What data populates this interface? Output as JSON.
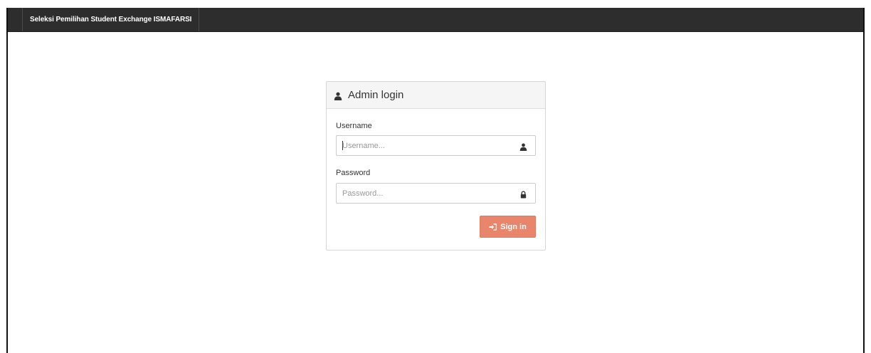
{
  "navbar": {
    "brand": "Seleksi Pemilihan Student Exchange ISMAFARSI"
  },
  "login_panel": {
    "title": "Admin login",
    "title_icon": "user-icon",
    "username": {
      "label": "Username",
      "placeholder": "Username...",
      "value": "",
      "icon": "user-icon"
    },
    "password": {
      "label": "Password",
      "placeholder": "Password...",
      "value": "",
      "icon": "lock-icon"
    },
    "submit": {
      "label": "Sign in",
      "icon": "sign-in-icon"
    }
  },
  "colors": {
    "navbar_bg": "#2d2d2d",
    "accent": "#e8856a",
    "panel_heading_bg": "#f5f5f5"
  }
}
